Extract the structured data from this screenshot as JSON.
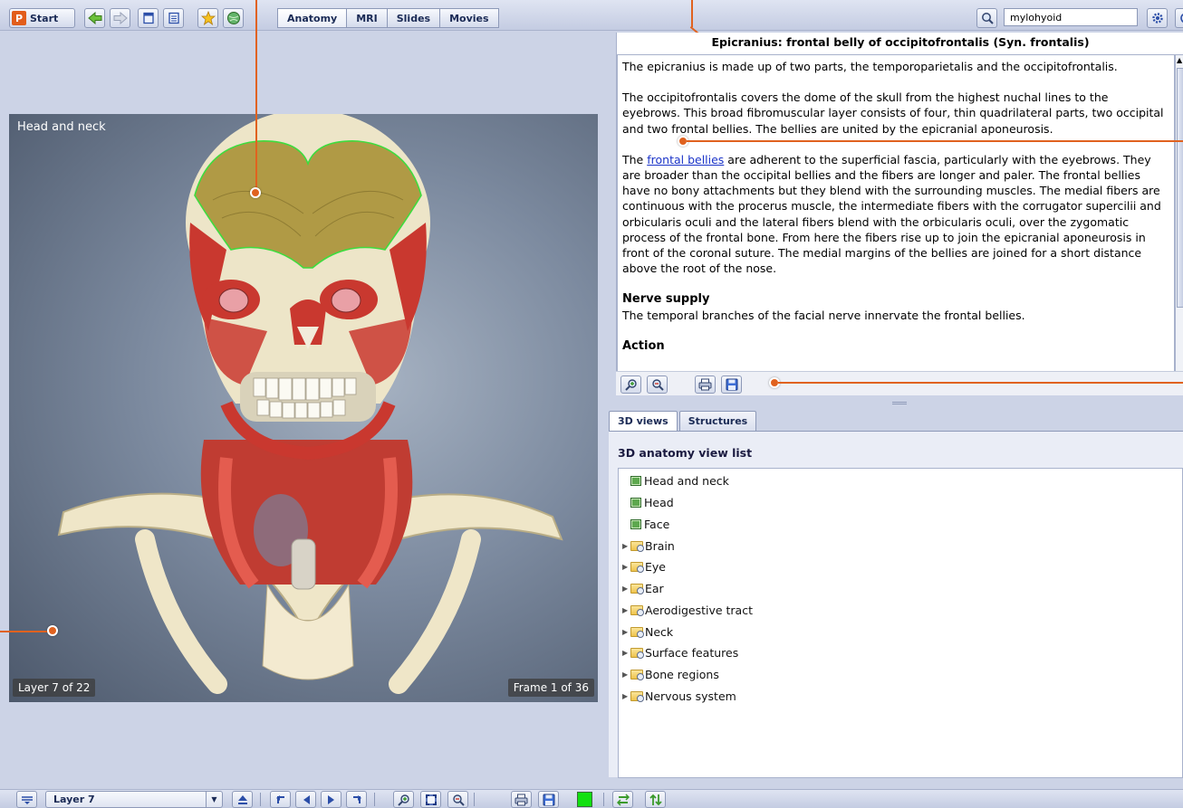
{
  "toolbar": {
    "start_label": "Start",
    "start_logo": "P",
    "nav_icons": [
      "back-arrow-icon",
      "forward-arrow-icon",
      "document-icon",
      "list-icon",
      "star-icon",
      "globe-icon"
    ],
    "modes": [
      "Anatomy",
      "MRI",
      "Slides",
      "Movies"
    ],
    "active_mode": "Anatomy",
    "search_value": "mylohyoid",
    "accent": "#e0621f"
  },
  "viewer": {
    "title": "Head and neck",
    "layer": "Layer 7 of 22",
    "frame": "Frame 1 of 36"
  },
  "info": {
    "title": "Epicranius: frontal belly of occipitofrontalis (Syn. frontalis)",
    "p1": "The epicranius is made up of two parts, the temporoparietalis and the occipitofrontalis.",
    "p2": "The occipitofrontalis covers the dome of the skull from the highest nuchal lines to the eyebrows. This broad fibromuscular layer consists of four, thin quadrilateral parts, two occipital and two frontal bellies. The bellies are united by the epicranial aponeurosis.",
    "p3_pre": "The ",
    "p3_link": "frontal bellies",
    "p3_rest": " are adherent to the superficial fascia, particularly with the eyebrows. They are broader than the occipital bellies and the fibers are longer and paler. The frontal bellies have no bony attachments but they blend with the surrounding muscles. The medial fibers are continuous with the procerus muscle, the intermediate fibers with the corrugator supercilii and orbicularis oculi and the lateral fibers blend with the orbicularis oculi, over the zygomatic process of the frontal bone. From here the fibers rise up to join the epicranial aponeurosis in front of the coronal suture. The medial margins of the bellies are joined for a short distance above the root of the nose.",
    "h_nerve": "Nerve supply",
    "nerve": "The temporal branches of the facial nerve innervate the frontal bellies.",
    "h_action": "Action"
  },
  "tabs": [
    "3D views",
    "Structures"
  ],
  "list": {
    "header": "3D anatomy view list",
    "items": [
      {
        "label": "Head and neck",
        "kind": "view"
      },
      {
        "label": "Head",
        "kind": "view"
      },
      {
        "label": "Face",
        "kind": "view"
      },
      {
        "label": "Brain",
        "kind": "folder"
      },
      {
        "label": "Eye",
        "kind": "folder"
      },
      {
        "label": "Ear",
        "kind": "folder"
      },
      {
        "label": "Aerodigestive tract",
        "kind": "folder"
      },
      {
        "label": "Neck",
        "kind": "folder"
      },
      {
        "label": "Surface features",
        "kind": "folder"
      },
      {
        "label": "Bone regions",
        "kind": "folder"
      },
      {
        "label": "Nervous system",
        "kind": "folder"
      }
    ]
  },
  "bottom": {
    "layer_select": "Layer 7",
    "color": "#12e012"
  }
}
